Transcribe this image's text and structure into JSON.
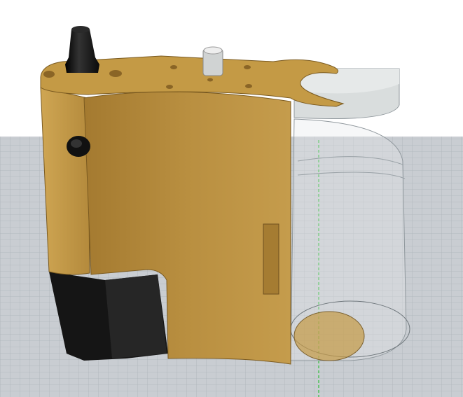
{
  "viewport": {
    "colors": {
      "background": "#ffffff",
      "grid_floor": "#c9cdd2",
      "grid_line": "#aeb4ba",
      "axis_green": "#2fbf3a",
      "body_gold": "#b48a3c",
      "body_gold_light": "#c9a350",
      "plate_gold": "#c49a45",
      "base_black": "#151515",
      "jar_lid": "#d9dddd",
      "jar_stroke": "#8f979c"
    }
  }
}
